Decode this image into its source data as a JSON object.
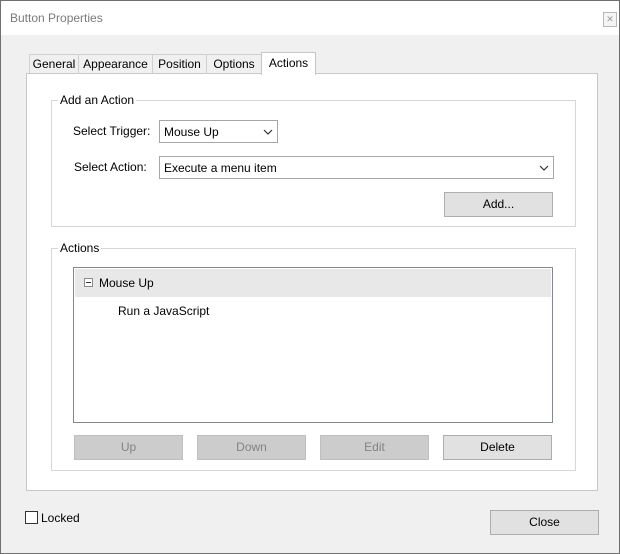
{
  "window": {
    "title": "Button Properties",
    "close_glyph": "✕"
  },
  "tabs": [
    {
      "label": "General"
    },
    {
      "label": "Appearance"
    },
    {
      "label": "Position"
    },
    {
      "label": "Options"
    },
    {
      "label": "Actions",
      "active": true
    }
  ],
  "add_action": {
    "legend": "Add an Action",
    "trigger_label": "Select Trigger:",
    "trigger_value": "Mouse Up",
    "action_label": "Select Action:",
    "action_value": "Execute a menu item",
    "add_button": "Add..."
  },
  "actions": {
    "legend": "Actions",
    "tree": [
      {
        "label": "Mouse Up",
        "expanded": true,
        "children": [
          "Run a JavaScript"
        ]
      }
    ],
    "buttons": {
      "up": "Up",
      "down": "Down",
      "edit": "Edit",
      "delete": "Delete"
    }
  },
  "footer": {
    "locked_label": "Locked",
    "locked_checked": false,
    "close_button": "Close"
  },
  "icons": {
    "chevron": "chevron-down-icon",
    "expander": "collapse-minus-icon",
    "close": "close-icon"
  },
  "colors": {
    "window_bg": "#f0f0f0",
    "panel_bg": "#ffffff",
    "selected_row": "#e8e8e8",
    "disabled_button": "#cccccc"
  }
}
